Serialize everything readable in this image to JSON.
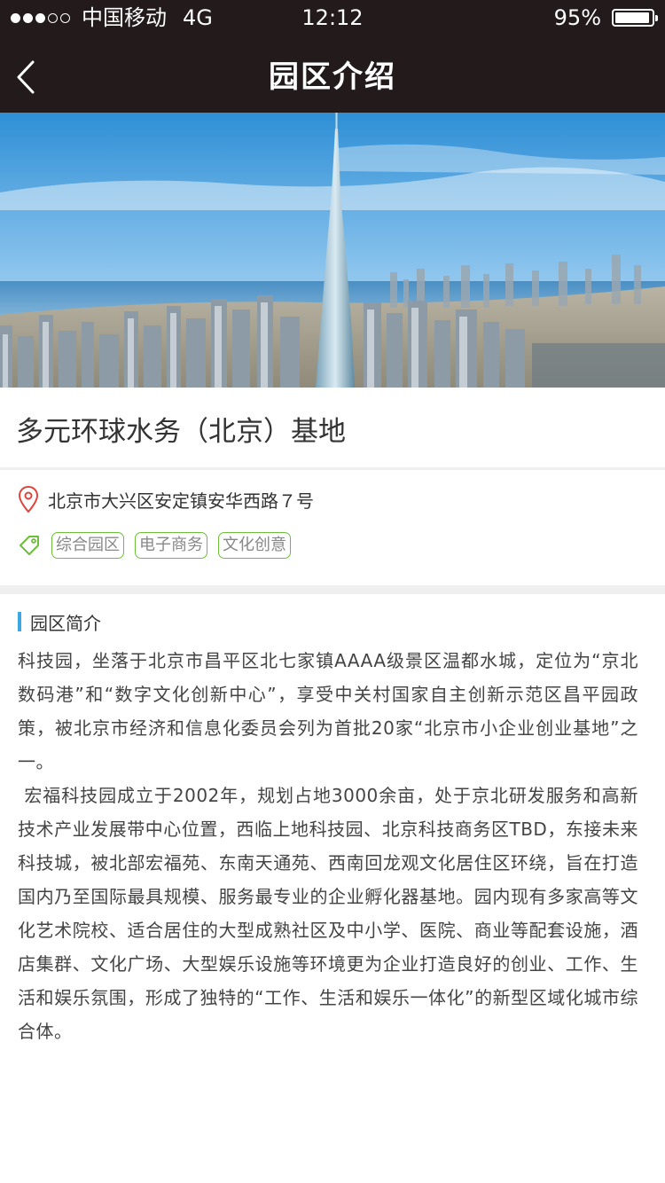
{
  "status_bar": {
    "carrier": "中国移动",
    "network": "4G",
    "time": "12:12",
    "battery": "95%",
    "battery_level": 0.95
  },
  "nav": {
    "title": "园区介绍"
  },
  "park": {
    "name": "多元环球水务（北京）基地",
    "address": "北京市大兴区安定镇安华西路７号",
    "tags": [
      "综合园区",
      "电子商务",
      "文化创意"
    ]
  },
  "intro": {
    "section_title": "园区简介",
    "paragraphs": [
      "科技园，坐落于北京市昌平区北七家镇AAAA级景区温都水城，定位为“京北数码港”和“数字文化创新中心”，享受中关村国家自主创新示范区昌平园政策，被北京市经济和信息化委员会列为首批20家“北京市小企业创业基地”之一。",
      " 宏福科技园成立于2002年，规划占地3000余亩，处于京北研发服务和高新技术产业发展带中心位置，西临上地科技园、北京科技商务区TBD，东接未来科技城，被北部宏福苑、东南天通苑、西南回龙观文化居住区环绕，旨在打造国内乃至国际最具规模、服务最专业的企业孵化器基地。园内现有多家高等文化艺术院校、适合居住的大型成熟社区及中小学、医院、商业等配套设施，酒店集群、文化广场、大型娱乐设施等环境更为企业打造良好的创业、工作、生活和娱乐氛围，形成了独特的“工作、生活和娱乐一体化”的新型区域化城市综合体。"
    ]
  },
  "colors": {
    "header_bg": "#231a1c",
    "tag_border": "#6cbf3a",
    "accent_bar": "#3ba7e3",
    "location_icon": "#e0443c"
  },
  "icons": {
    "back": "chevron-left-icon",
    "location": "location-pin-icon",
    "tag": "tag-icon"
  }
}
